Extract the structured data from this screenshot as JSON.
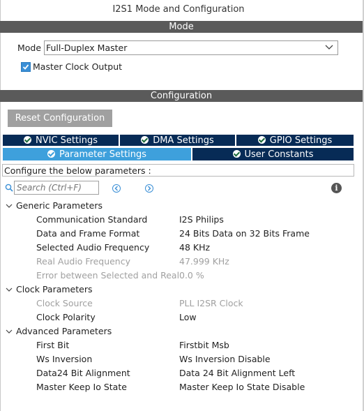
{
  "window": {
    "title": "I2S1 Mode and Configuration"
  },
  "mode_section": {
    "header": "Mode",
    "mode_label": "Mode",
    "mode_value": "Full-Duplex Master",
    "master_clock_output": {
      "label": "Master Clock Output",
      "checked": true
    }
  },
  "config_section": {
    "header": "Configuration",
    "reset_button": "Reset Configuration",
    "tabs_row1": [
      {
        "label": "NVIC Settings",
        "icon": "check-icon",
        "active": false
      },
      {
        "label": "DMA Settings",
        "icon": "check-icon",
        "active": false
      },
      {
        "label": "GPIO Settings",
        "icon": "check-icon",
        "active": false
      }
    ],
    "tabs_row2": [
      {
        "label": "Parameter Settings",
        "icon": "check-icon",
        "active": true
      },
      {
        "label": "User Constants",
        "icon": "check-icon",
        "active": false
      }
    ],
    "hint": "Configure the below parameters :",
    "search": {
      "placeholder": "Search (Ctrl+F)",
      "value": ""
    }
  },
  "parameters": {
    "groups": [
      {
        "name": "Generic Parameters",
        "expanded": true,
        "rows": [
          {
            "name": "Communication Standard",
            "value": "I2S Philips",
            "enabled": true
          },
          {
            "name": "Data and Frame Format",
            "value": "24 Bits Data on 32 Bits Frame",
            "enabled": true
          },
          {
            "name": "Selected Audio Frequency",
            "value": "48 KHz",
            "enabled": true
          },
          {
            "name": "Real Audio Frequency",
            "value": "47.999 KHz",
            "enabled": false
          },
          {
            "name": "Error between Selected and Real",
            "value": "0.0 %",
            "enabled": false
          }
        ]
      },
      {
        "name": "Clock Parameters",
        "expanded": true,
        "rows": [
          {
            "name": "Clock Source",
            "value": "PLL I2SR Clock",
            "enabled": false
          },
          {
            "name": "Clock Polarity",
            "value": "Low",
            "enabled": true
          }
        ]
      },
      {
        "name": "Advanced Parameters",
        "expanded": true,
        "rows": [
          {
            "name": "First Bit",
            "value": "Firstbit Msb",
            "enabled": true
          },
          {
            "name": "Ws Inversion",
            "value": "Ws Inversion Disable",
            "enabled": true
          },
          {
            "name": "Data24 Bit Alignment",
            "value": "Data 24 Bit Alignment Left",
            "enabled": true
          },
          {
            "name": "Master Keep Io State",
            "value": "Master Keep Io State Disable",
            "enabled": true
          }
        ]
      }
    ]
  },
  "colors": {
    "section_bar": "#5a5a5a",
    "tab_dark": "#072b56",
    "tab_active": "#3ea0dc",
    "accent": "#3a8fd6",
    "disabled_text": "#a0a0a0"
  }
}
